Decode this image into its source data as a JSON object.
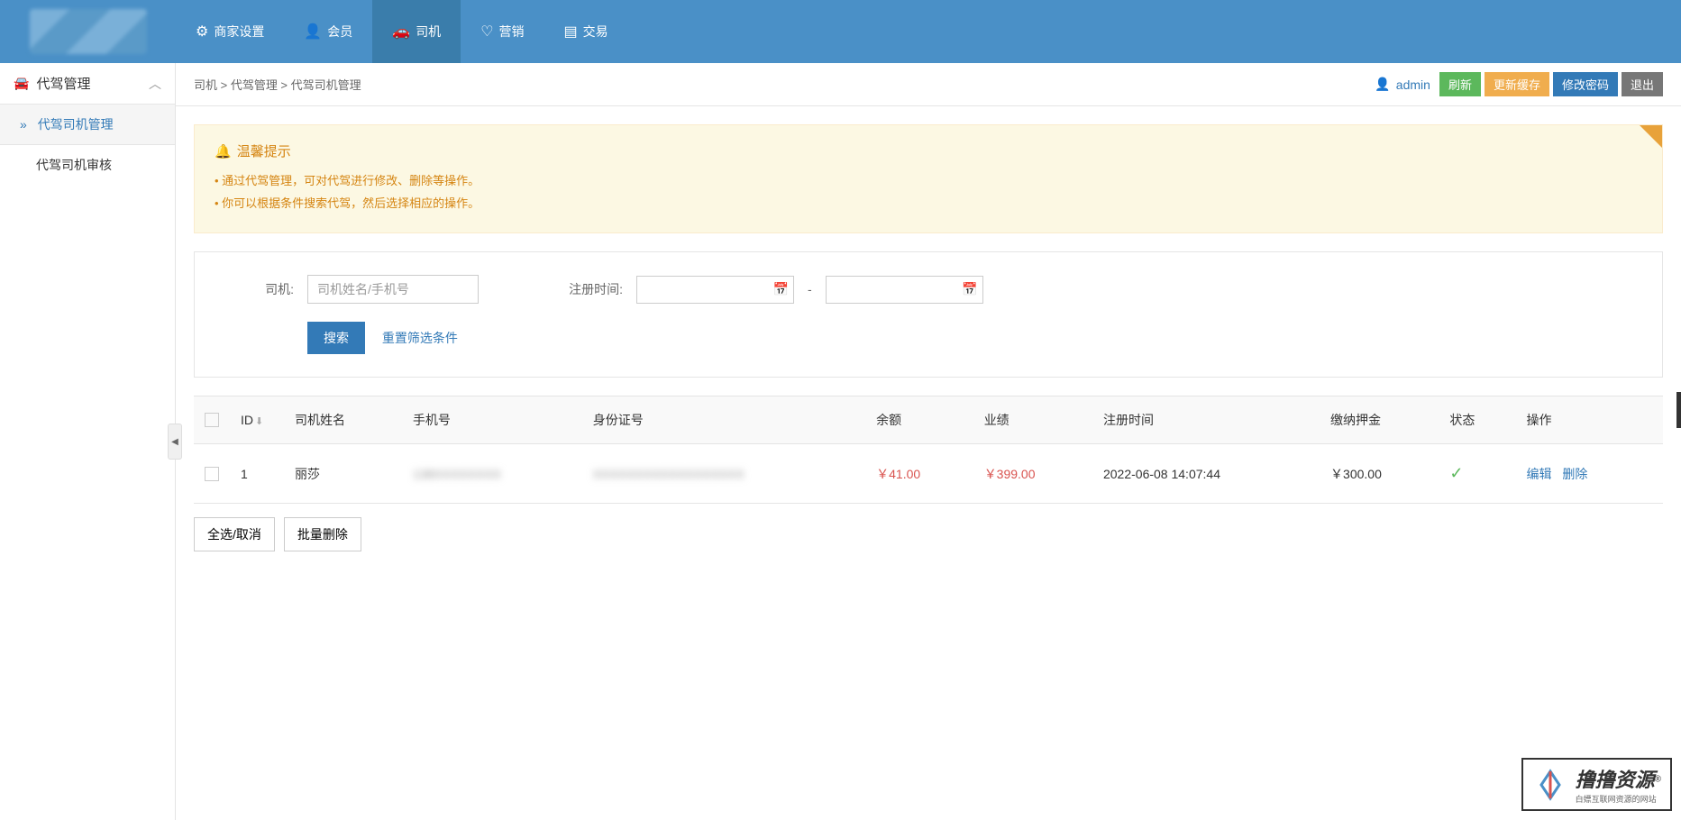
{
  "nav": {
    "items": [
      {
        "icon": "⚙",
        "label": "商家设置"
      },
      {
        "icon": "👤",
        "label": "会员"
      },
      {
        "icon": "🚗",
        "label": "司机"
      },
      {
        "icon": "💬",
        "label": "营销"
      },
      {
        "icon": "📋",
        "label": "交易"
      }
    ]
  },
  "sidebar": {
    "title": "代驾管理",
    "items": [
      {
        "label": "代驾司机管理"
      },
      {
        "label": "代驾司机审核"
      }
    ]
  },
  "breadcrumb": "司机 > 代驾管理 > 代驾司机管理",
  "user": {
    "name": "admin"
  },
  "topButtons": {
    "refresh": "刷新",
    "updateCache": "更新缓存",
    "changePwd": "修改密码",
    "logout": "退出"
  },
  "notice": {
    "title": "温馨提示",
    "line1": "通过代驾管理，可对代驾进行修改、删除等操作。",
    "line2": "你可以根据条件搜索代驾，然后选择相应的操作。"
  },
  "search": {
    "driverLabel": "司机:",
    "driverPlaceholder": "司机姓名/手机号",
    "regTimeLabel": "注册时间:",
    "dash": "-",
    "searchBtn": "搜索",
    "resetLink": "重置筛选条件"
  },
  "table": {
    "headers": {
      "id": "ID",
      "name": "司机姓名",
      "phone": "手机号",
      "idcard": "身份证号",
      "balance": "余额",
      "performance": "业绩",
      "regtime": "注册时间",
      "deposit": "缴纳押金",
      "status": "状态",
      "action": "操作"
    },
    "rows": [
      {
        "id": "1",
        "name": "丽莎",
        "phone": "138XXXXXXXX",
        "idcard": "XXXXXXXXXXXXXXXXXX",
        "balance": "￥41.00",
        "performance": "￥399.00",
        "regtime": "2022-06-08 14:07:44",
        "deposit": "￥300.00"
      }
    ],
    "actions": {
      "edit": "编辑",
      "delete": "删除"
    }
  },
  "bottomActions": {
    "selectAll": "全选/取消",
    "batchDelete": "批量删除"
  },
  "watermark": {
    "main": "撸撸资源",
    "sub": "白嫖互联网资源的网站"
  }
}
